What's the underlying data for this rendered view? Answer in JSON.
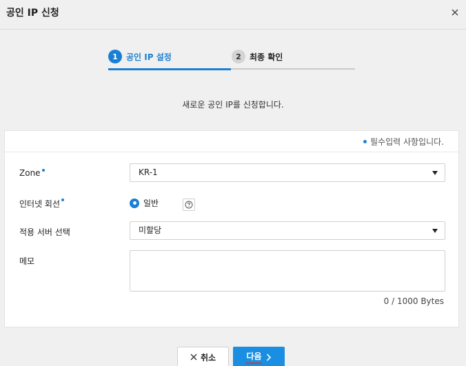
{
  "dialog": {
    "title": "공인 IP 신청"
  },
  "steps": [
    {
      "number": "1",
      "label": "공인 IP 설정",
      "active": true
    },
    {
      "number": "2",
      "label": "최종 확인",
      "active": false
    }
  ],
  "description": "새로운 공인 IP를 신청합니다.",
  "form": {
    "required_note": "필수입력 사항입니다.",
    "zone": {
      "label": "Zone",
      "value": "KR-1",
      "required": true
    },
    "internet_line": {
      "label": "인터넷 회선",
      "option": "일반",
      "selected": true,
      "required": true
    },
    "server": {
      "label": "적용 서버 선택",
      "value": "미할당"
    },
    "memo": {
      "label": "메모",
      "value": "",
      "counter": "0 / 1000 Bytes"
    }
  },
  "buttons": {
    "cancel": "취소",
    "next": "다음"
  },
  "colors": {
    "accent": "#1a7fd4",
    "primary_button": "#1a8ee0",
    "background": "#f0f0f0"
  },
  "icons": {
    "close": "close-icon",
    "help": "help-icon",
    "cancel": "x-icon",
    "next": "chevron-right-icon",
    "dropdown": "caret-down-icon"
  }
}
